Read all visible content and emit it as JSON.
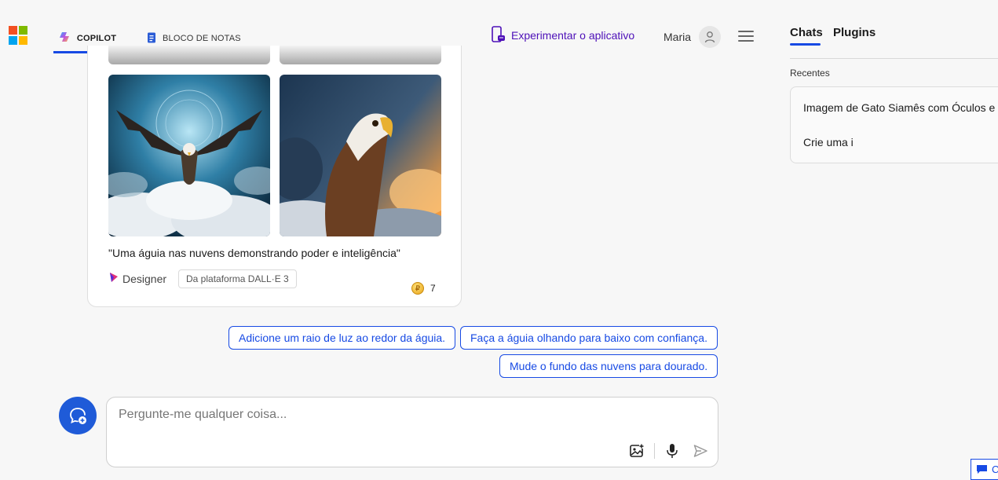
{
  "header": {
    "tabs": [
      {
        "label": "COPILOT",
        "active": true
      },
      {
        "label": "BLOCO DE NOTAS",
        "active": false
      }
    ],
    "try_app": "Experimentar o aplicativo",
    "user_name": "Maria"
  },
  "panel": {
    "tabs": [
      "Chats",
      "Plugins"
    ],
    "recent_label": "Recentes",
    "recent_items": [
      "Imagem de Gato Siamês com Óculos e",
      "Crie uma i"
    ]
  },
  "response": {
    "images": [
      {
        "alt": "eagle-flying-clouds"
      },
      {
        "alt": "eagle-portrait-clouds"
      }
    ],
    "caption": "\"Uma águia nas nuvens demonstrando poder e inteligência\"",
    "designer_label": "Designer",
    "platform_badge": "Da plataforma DALL·E 3",
    "boost_count": "7"
  },
  "suggestions": [
    "Adicione um raio de luz ao redor da águia.",
    "Faça a águia olhando para baixo com confiança.",
    "Mude o fundo das nuvens para dourado."
  ],
  "input": {
    "placeholder": "Pergunte-me qualquer coisa...",
    "value": ""
  },
  "feedback_label": "C",
  "colors": {
    "accent": "#174ae4",
    "try_app": "#4d10b8",
    "background": "#f7f7f7"
  }
}
